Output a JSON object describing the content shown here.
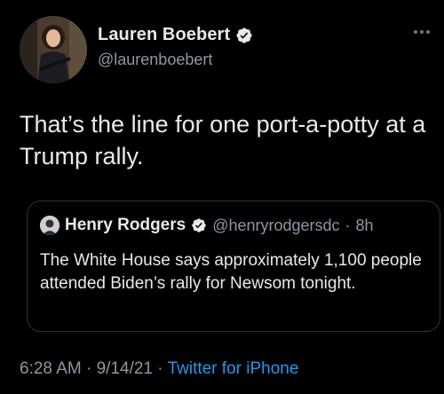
{
  "colors": {
    "background": "#000000",
    "primary_text": "#e7e9ea",
    "secondary_text": "#8b98a5",
    "link": "#1d9bf0",
    "verified_badge": "#e7e9ea",
    "border": "#2f3336"
  },
  "author": {
    "display_name": "Lauren Boebert",
    "handle": "@laurenboebert",
    "verified_icon": "verified-badge-icon",
    "avatar_icon": "profile-photo"
  },
  "more_icon": "more-options-icon",
  "tweet": {
    "text": "That’s the line for one port-a-potty at a Trump rally."
  },
  "quoted_tweet": {
    "display_name": "Henry Rodgers",
    "handle": "@henryrodgersdc",
    "separator": "·",
    "time": "8h",
    "verified_icon": "verified-badge-icon",
    "text": "The White House says approximately 1,100 people attended Biden’s rally for Newsom tonight."
  },
  "footer": {
    "time": "6:28 AM",
    "separator_1": " · ",
    "date": "9/14/21",
    "separator_2": " · ",
    "source": "Twitter for iPhone"
  }
}
